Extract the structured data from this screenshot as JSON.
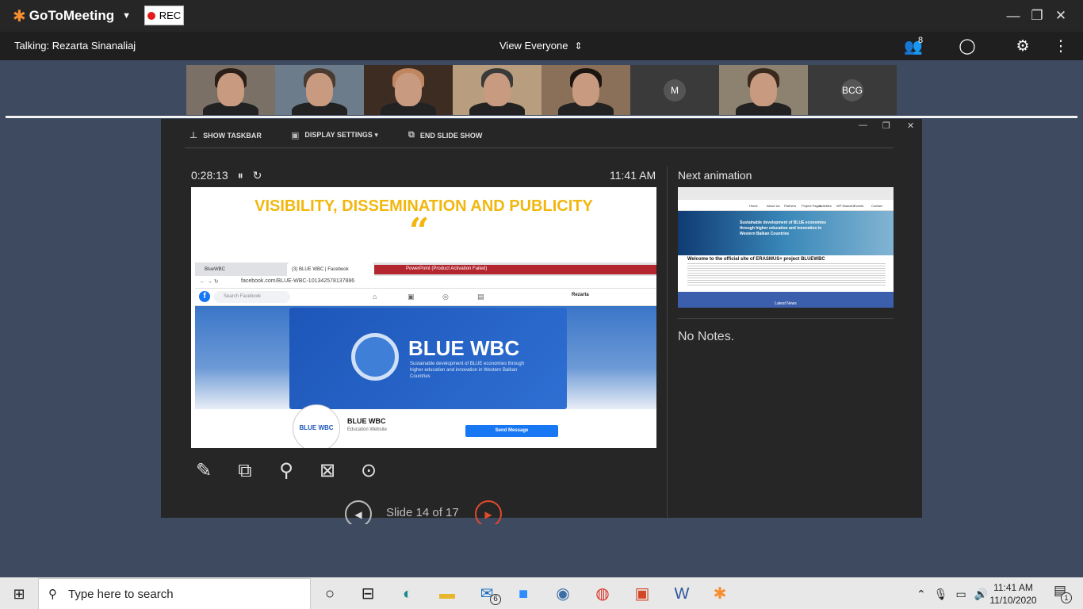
{
  "titlebar": {
    "app_name": "GoToMeeting",
    "rec_label": "REC",
    "colors": {
      "accent": "#f68d2e",
      "rec": "#e21b1b",
      "background": "#262626"
    }
  },
  "toolbar": {
    "talking": "Talking: Rezarta Sinanaliaj",
    "view_selector": "View Everyone",
    "attendee_count": "8"
  },
  "thumbnails": [
    {
      "type": "video",
      "hair": "#2a1e17",
      "bg": "#7a7065"
    },
    {
      "type": "video",
      "hair": "#4a3a30",
      "bg": "#6d7c8a"
    },
    {
      "type": "video",
      "hair": "#c08660",
      "bg": "#3c2c22"
    },
    {
      "type": "video",
      "hair": "#3a3a3a",
      "bg": "#b89e7e"
    },
    {
      "type": "video",
      "hair": "#1c1410",
      "bg": "#8a7058"
    },
    {
      "type": "avatar",
      "initials": "M",
      "bg": "#3a3a3a"
    },
    {
      "type": "video",
      "hair": "#3a2a1e",
      "bg": "#8d8170"
    },
    {
      "type": "avatar",
      "initials": "BCG",
      "bg": "#3a3a3a"
    }
  ],
  "presenter": {
    "menu": {
      "show_taskbar": "SHOW TASKBAR",
      "display_settings": "DISPLAY SETTINGS ▾",
      "end_slide_show": "END SLIDE SHOW"
    },
    "timer": "0:28:13",
    "clock": "11:41 AM",
    "slide_counter": "Slide 14 of 17",
    "next_label": "Next animation",
    "notes": "No Notes."
  },
  "slide": {
    "title": "VISIBILITY, DISSEMINATION AND PUBLICITY",
    "tabs": [
      "BlueWBC",
      "(3) BLUE WBC | Facebook",
      "PowerPoint (Product Activation Failed)"
    ],
    "url": "facebook.com/BLUE-WBC-101342578137886",
    "search_placeholder": "Search Facebook",
    "user_name": "Rezarta",
    "brand": "BLUE WBC",
    "tagline": "Sustainable development of BLUE economies through higher education and innovation in Western Balkan Countries",
    "page_name": "BLUE WBC",
    "page_type": "Education Website",
    "page_logo_text": "BLUE WBC",
    "send_message": "Send Message"
  },
  "next_preview": {
    "nav_items": [
      "Home",
      "About Us",
      "Partners",
      "Project Pages",
      "Activities",
      "WP Modules",
      "Events",
      "Contact"
    ],
    "hero_text": "Sustainable development of BLUE economies through higher education and innovation in Western Balkan Countries",
    "welcome": "Welcome to the official site of ERASMUS+ project BLUEWBC",
    "latest": "Latest News"
  },
  "taskbar": {
    "search_placeholder": "Type here to search",
    "mail_badge": "6",
    "time": "11:41 AM",
    "date": "11/10/2020",
    "notif_badge": "1"
  }
}
